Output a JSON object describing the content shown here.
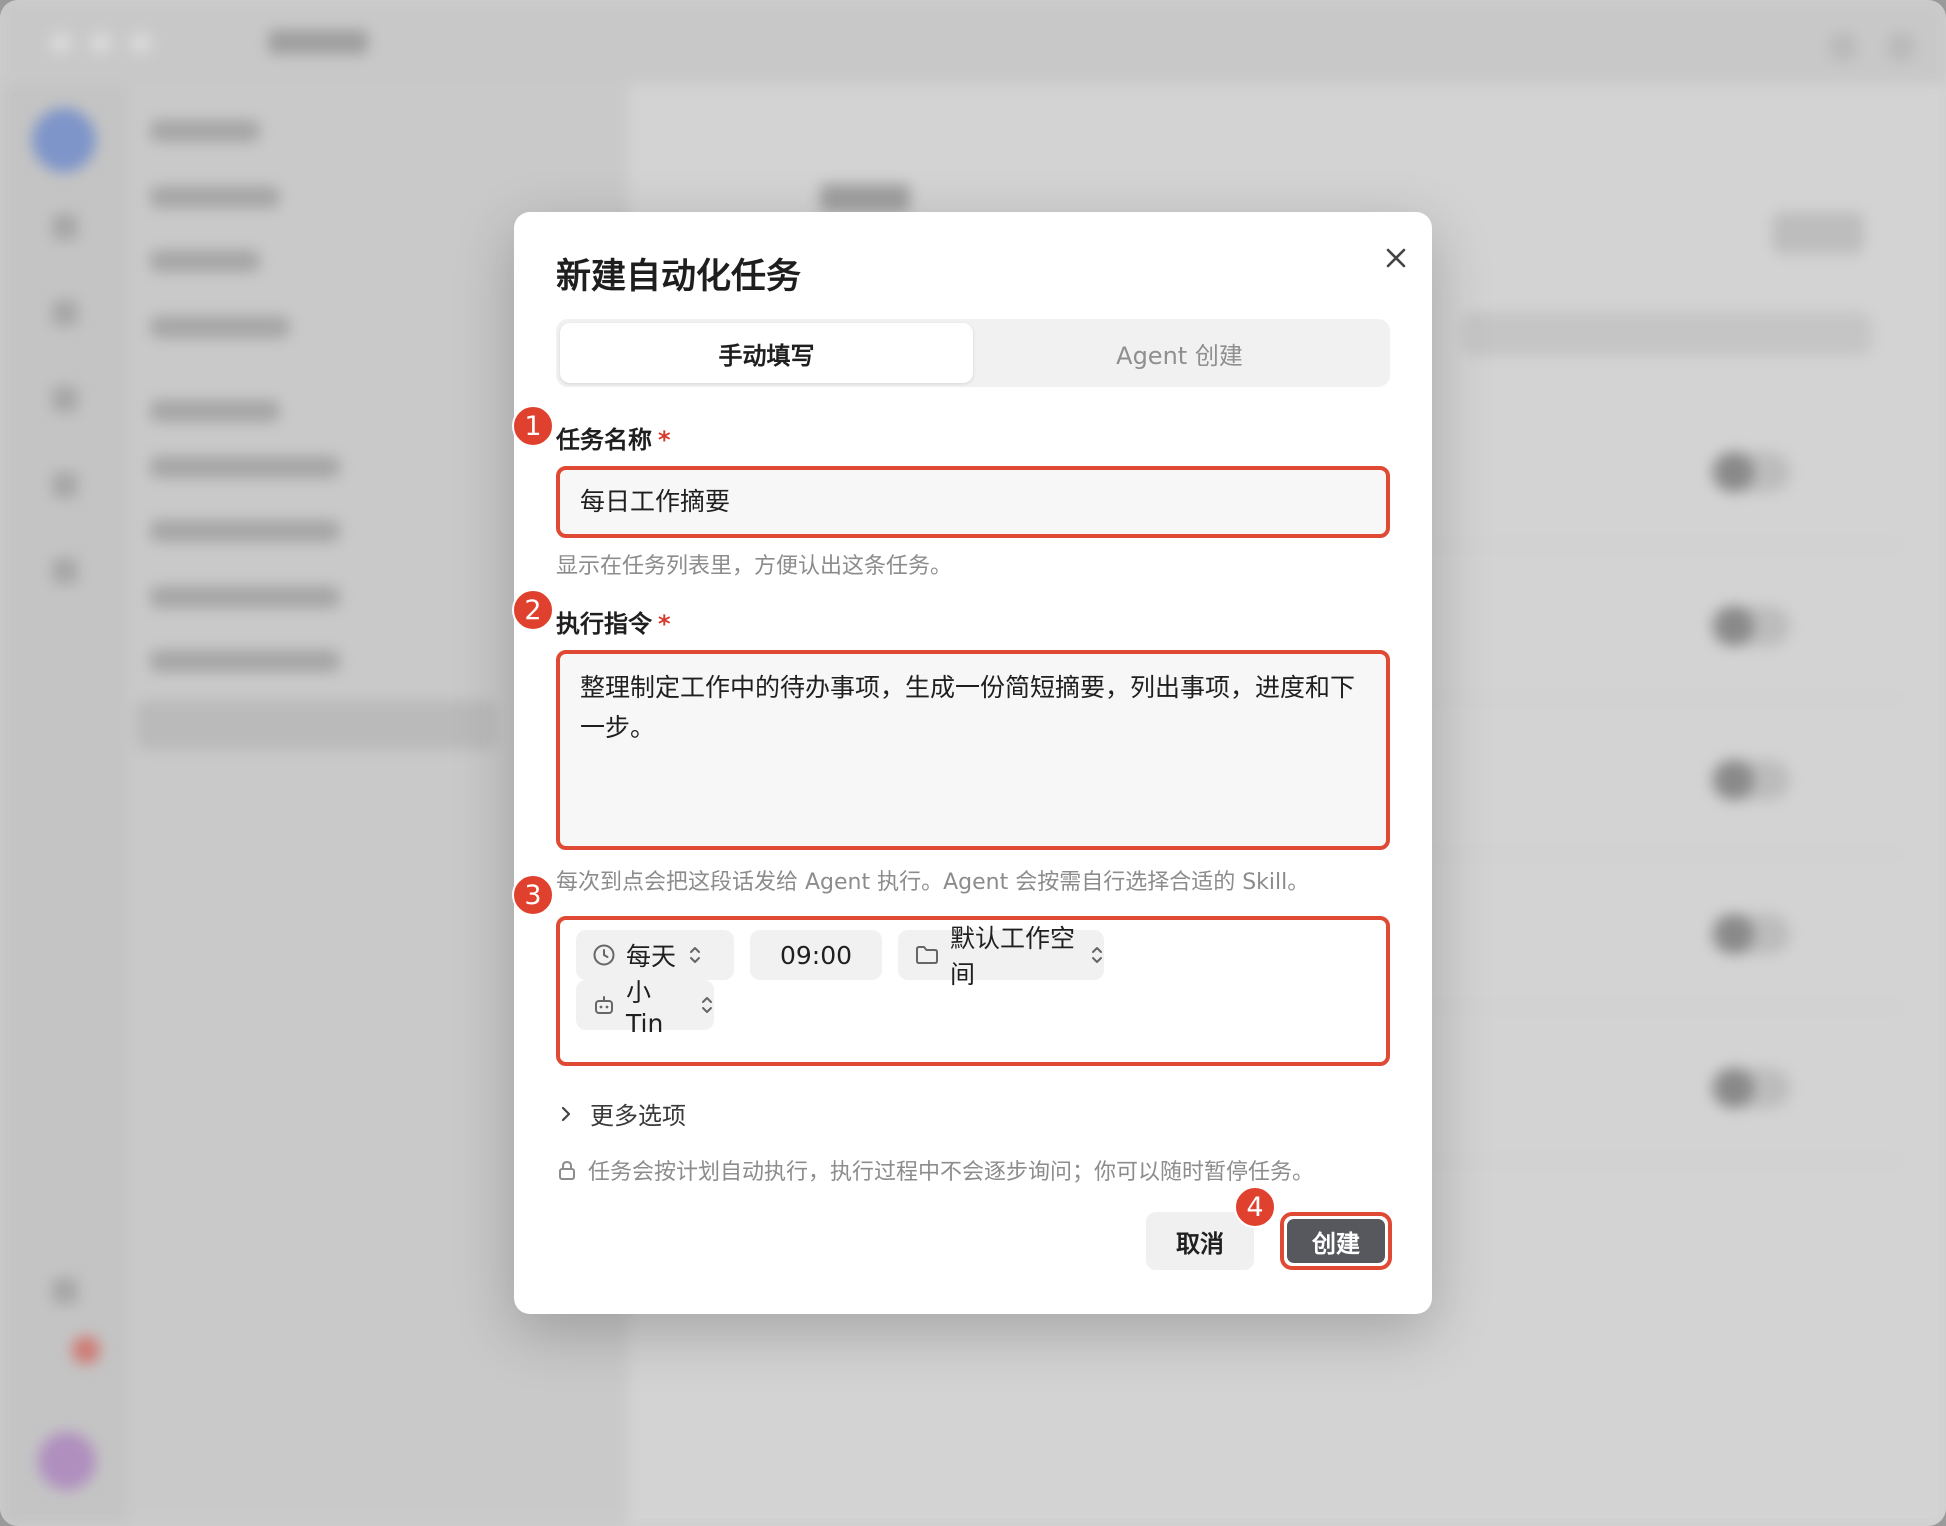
{
  "dialog": {
    "title": "新建自动化任务",
    "tabs": [
      {
        "label": "手动填写",
        "active": true
      },
      {
        "label": "Agent 创建",
        "active": false
      }
    ]
  },
  "form": {
    "task_name": {
      "label": "任务名称",
      "required_mark": "*",
      "value": "每日工作摘要",
      "hint": "显示在任务列表里，方便认出这条任务。"
    },
    "instruction": {
      "label": "执行指令",
      "required_mark": "*",
      "value": "整理制定工作中的待办事项，生成一份简短摘要，列出事项，进度和下一步。",
      "hint": "每次到点会把这段话发给 Agent 执行。Agent 会按需自行选择合适的 Skill。"
    },
    "options": {
      "frequency": "每天",
      "time": "09:00",
      "workspace": "默认工作空间",
      "agent": "小Tin"
    },
    "more_options": "更多选项",
    "notice": "任务会按计划自动执行，执行过程中不会逐步询问；你可以随时暂停任务。"
  },
  "actions": {
    "cancel": "取消",
    "create": "创建"
  },
  "annotations": [
    "1",
    "2",
    "3",
    "4"
  ],
  "colors": {
    "highlight": "#e04a35",
    "badge": "#e0412f",
    "primary_button": "#56585e"
  }
}
